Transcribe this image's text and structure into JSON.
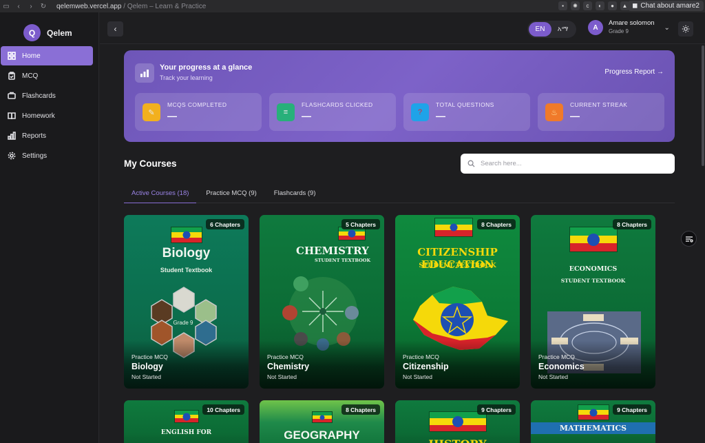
{
  "browser": {
    "url_domain": "qelemweb.vercel.app",
    "page_title": "Qelem – Learn & Practice",
    "chat_label": "Chat about amare2"
  },
  "brand": {
    "logo_letter": "Q",
    "name": "Qelem"
  },
  "nav": {
    "items": [
      {
        "label": "Home",
        "icon": "grid-icon",
        "active": true
      },
      {
        "label": "MCQ",
        "icon": "clipboard-icon",
        "active": false
      },
      {
        "label": "Flashcards",
        "icon": "cards-icon",
        "active": false
      },
      {
        "label": "Homework",
        "icon": "book-icon",
        "active": false
      },
      {
        "label": "Reports",
        "icon": "bar-chart-icon",
        "active": false
      },
      {
        "label": "Settings",
        "icon": "gear-icon",
        "active": false
      }
    ]
  },
  "header": {
    "lang_en": "EN",
    "lang_am": "አማ",
    "user_initial": "A",
    "user_name": "Amare solomon",
    "user_grade": "Grade 9"
  },
  "progress": {
    "title": "Your progress at a glance",
    "subtitle": "Track your learning",
    "report_link": "Progress Report →",
    "stats": [
      {
        "label": "MCQS COMPLETED",
        "value": "—",
        "color": "#f2b01e",
        "icon": "notes-icon"
      },
      {
        "label": "FLASHCARDS CLICKED",
        "value": "—",
        "color": "#27b07a",
        "icon": "books-icon"
      },
      {
        "label": "TOTAL QUESTIONS",
        "value": "—",
        "color": "#1fa3e8",
        "icon": "question-icon"
      },
      {
        "label": "CURRENT STREAK",
        "value": "—",
        "color": "#f07a2a",
        "icon": "fire-icon"
      }
    ]
  },
  "courses": {
    "title": "My Courses",
    "search_placeholder": "Search here...",
    "tabs": [
      {
        "label": "Active Courses (18)",
        "active": true
      },
      {
        "label": "Practice MCQ (9)",
        "active": false
      },
      {
        "label": "Flashcards (9)",
        "active": false
      }
    ],
    "cards": [
      {
        "chapters": "6 Chapters",
        "cover_title": "Biology",
        "cover_sub": "Student Textbook",
        "kind": "Practice MCQ",
        "name": "Biology",
        "status": "Not Started"
      },
      {
        "chapters": "5 Chapters",
        "cover_title": "CHEMISTRY",
        "cover_sub": "STUDENT TEXTBOOK",
        "kind": "Practice MCQ",
        "name": "Chemistry",
        "status": "Not Started"
      },
      {
        "chapters": "8 Chapters",
        "cover_title": "CITIZENSHIP EDUCATION",
        "cover_sub": "STUDENT TEXTBOOK",
        "kind": "Practice MCQ",
        "name": "Citizenship",
        "status": "Not Started"
      },
      {
        "chapters": "8 Chapters",
        "cover_title": "ECONOMICS",
        "cover_sub": "STUDENT TEXTBOOK",
        "kind": "Practice MCQ",
        "name": "Economics",
        "status": "Not Started"
      },
      {
        "chapters": "10 Chapters",
        "cover_title": "ENGLISH FOR"
      },
      {
        "chapters": "8 Chapters",
        "cover_title": "GEOGRAPHY"
      },
      {
        "chapters": "9 Chapters",
        "cover_title": "HISTORY"
      },
      {
        "chapters": "9 Chapters",
        "cover_title": "MATHEMATICS"
      }
    ]
  }
}
